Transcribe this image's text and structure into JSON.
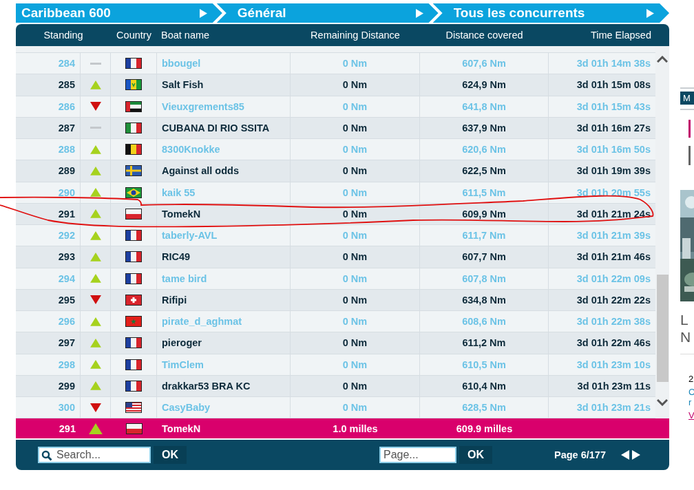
{
  "breadcrumbs": [
    {
      "label": "Caribbean 600"
    },
    {
      "label": "Général"
    },
    {
      "label": "Tous les concurrents"
    }
  ],
  "table": {
    "columns": [
      "Standing",
      "Country",
      "Boat name",
      "Remaining Distance",
      "Distance covered",
      "Time Elapsed"
    ],
    "rows": [
      {
        "standing": "284",
        "trend": {
          "kind": "same"
        },
        "flag": {
          "kind": "fr"
        },
        "boat": "bbougel",
        "remaining": "0 Nm",
        "covered": "607,6 Nm",
        "elapsed": "3d 01h 14m 38s"
      },
      {
        "standing": "285",
        "trend": {
          "kind": "up"
        },
        "flag": {
          "kind": "vc"
        },
        "boat": "Salt Fish",
        "remaining": "0 Nm",
        "covered": "624,9 Nm",
        "elapsed": "3d 01h 15m 08s"
      },
      {
        "standing": "286",
        "trend": {
          "kind": "down"
        },
        "flag": {
          "kind": "ae"
        },
        "boat": "Vieuxgrements85",
        "remaining": "0 Nm",
        "covered": "641,8 Nm",
        "elapsed": "3d 01h 15m 43s"
      },
      {
        "standing": "287",
        "trend": {
          "kind": "same"
        },
        "flag": {
          "kind": "it"
        },
        "boat": "CUBANA DI RIO SSITA",
        "remaining": "0 Nm",
        "covered": "637,9 Nm",
        "elapsed": "3d 01h 16m 27s"
      },
      {
        "standing": "288",
        "trend": {
          "kind": "up"
        },
        "flag": {
          "kind": "be"
        },
        "boat": "8300Knokke",
        "remaining": "0 Nm",
        "covered": "620,6 Nm",
        "elapsed": "3d 01h 16m 50s"
      },
      {
        "standing": "289",
        "trend": {
          "kind": "up"
        },
        "flag": {
          "kind": "se"
        },
        "boat": "Against all odds",
        "remaining": "0 Nm",
        "covered": "622,5 Nm",
        "elapsed": "3d 01h 19m 39s"
      },
      {
        "standing": "290",
        "trend": {
          "kind": "up"
        },
        "flag": {
          "kind": "br"
        },
        "boat": "kaik 55",
        "remaining": "0 Nm",
        "covered": "611,5 Nm",
        "elapsed": "3d 01h 20m 55s"
      },
      {
        "standing": "291",
        "trend": {
          "kind": "up"
        },
        "flag": {
          "kind": "pl"
        },
        "boat": "TomekN",
        "remaining": "0 Nm",
        "covered": "609,9 Nm",
        "elapsed": "3d 01h 21m 24s"
      },
      {
        "standing": "292",
        "trend": {
          "kind": "up"
        },
        "flag": {
          "kind": "fr"
        },
        "boat": "taberly-AVL",
        "remaining": "0 Nm",
        "covered": "611,7 Nm",
        "elapsed": "3d 01h 21m 39s"
      },
      {
        "standing": "293",
        "trend": {
          "kind": "up"
        },
        "flag": {
          "kind": "fr"
        },
        "boat": "RIC49",
        "remaining": "0 Nm",
        "covered": "607,7 Nm",
        "elapsed": "3d 01h 21m 46s"
      },
      {
        "standing": "294",
        "trend": {
          "kind": "up"
        },
        "flag": {
          "kind": "fr"
        },
        "boat": "tame bird",
        "remaining": "0 Nm",
        "covered": "607,8 Nm",
        "elapsed": "3d 01h 22m 09s"
      },
      {
        "standing": "295",
        "trend": {
          "kind": "down"
        },
        "flag": {
          "kind": "ch"
        },
        "boat": "Rifipi",
        "remaining": "0 Nm",
        "covered": "634,8 Nm",
        "elapsed": "3d 01h 22m 22s"
      },
      {
        "standing": "296",
        "trend": {
          "kind": "up"
        },
        "flag": {
          "kind": "ma"
        },
        "boat": "pirate_d_aghmat",
        "remaining": "0 Nm",
        "covered": "608,6 Nm",
        "elapsed": "3d 01h 22m 38s"
      },
      {
        "standing": "297",
        "trend": {
          "kind": "up"
        },
        "flag": {
          "kind": "fr"
        },
        "boat": "pieroger",
        "remaining": "0 Nm",
        "covered": "611,2 Nm",
        "elapsed": "3d 01h 22m 46s"
      },
      {
        "standing": "298",
        "trend": {
          "kind": "up"
        },
        "flag": {
          "kind": "fr"
        },
        "boat": "TimClem",
        "remaining": "0 Nm",
        "covered": "610,5 Nm",
        "elapsed": "3d 01h 23m 10s"
      },
      {
        "standing": "299",
        "trend": {
          "kind": "up"
        },
        "flag": {
          "kind": "fr"
        },
        "boat": "drakkar53 BRA KC",
        "remaining": "0 Nm",
        "covered": "610,4 Nm",
        "elapsed": "3d 01h 23m 11s"
      },
      {
        "standing": "300",
        "trend": {
          "kind": "down"
        },
        "flag": {
          "kind": "us"
        },
        "boat": "CasyBaby",
        "remaining": "0 Nm",
        "covered": "628,5 Nm",
        "elapsed": "3d 01h 23m 21s"
      }
    ],
    "my_boat": {
      "standing": "291",
      "trend": {
        "kind": "up"
      },
      "flag": {
        "kind": "pl"
      },
      "boat": "TomekN",
      "remaining": "1.0 milles",
      "covered": "609.9 milles"
    }
  },
  "footer": {
    "search": {
      "placeholder": "Search...",
      "button": "OK"
    },
    "page_field": {
      "placeholder": "Page...",
      "button": "OK"
    },
    "page_label": "Page 6/177"
  },
  "side_panel": {
    "badge": "M",
    "heading_lines": [
      "L",
      "N"
    ],
    "date": "2",
    "text_lines": [
      "C",
      "r"
    ],
    "link": "V"
  }
}
